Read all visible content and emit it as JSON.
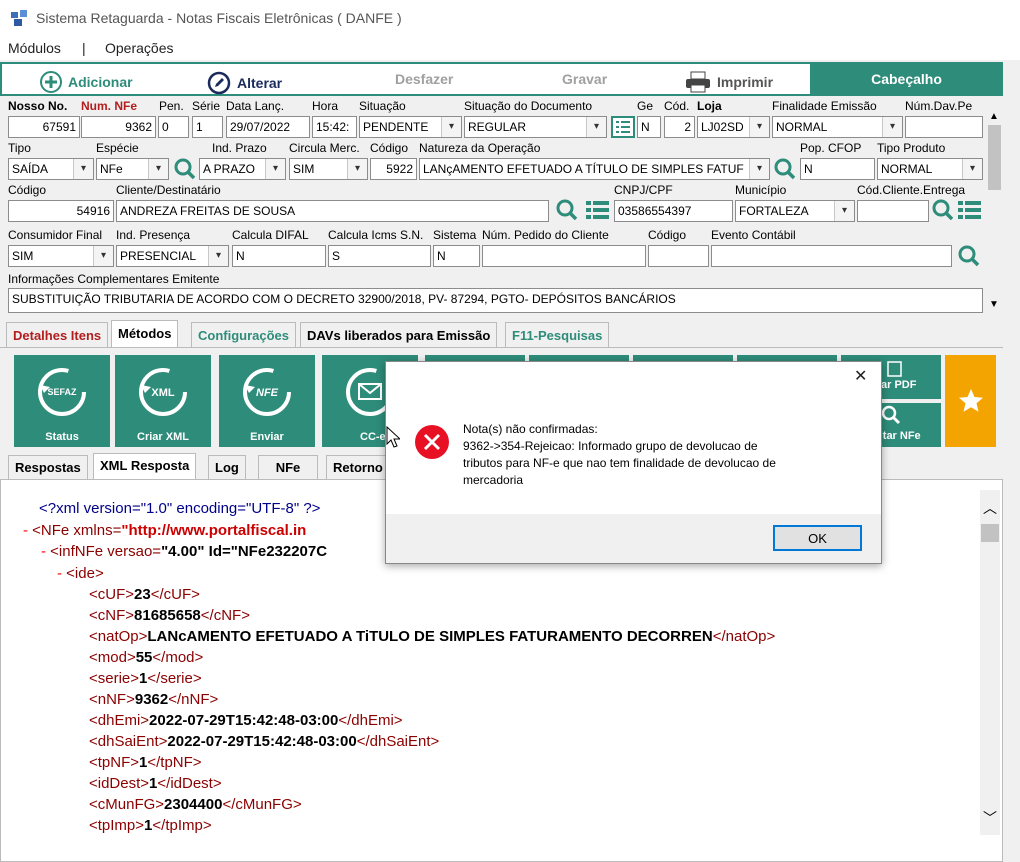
{
  "app": {
    "title": "Sistema Retaguarda - Notas Fiscais Eletrônicas ( DANFE )"
  },
  "menu": {
    "modulos": "Módulos",
    "sep": "|",
    "operacoes": "Operações"
  },
  "toolbar": {
    "adicionar": "Adicionar",
    "alterar": "Alterar",
    "desfazer": "Desfazer",
    "gravar": "Gravar",
    "imprimir": "Imprimir",
    "cabecalho": "Cabeçalho"
  },
  "form": {
    "row1": {
      "labels": {
        "nosso_no": "Nosso No.",
        "num_nfe": "Num. NFe",
        "pen": "Pen.",
        "serie": "Série",
        "data_lanc": "Data Lanç.",
        "hora": "Hora",
        "situacao": "Situação",
        "sit_doc": "Situação do Documento",
        "ge": "Ge",
        "cod": "Cód.",
        "loja": "Loja",
        "finalidade": "Finalidade Emissão",
        "num_dav": "Núm.Dav.Pe"
      },
      "values": {
        "nosso_no": "67591",
        "num_nfe": "9362",
        "pen": "0",
        "serie": "1",
        "data_lanc": "29/07/2022",
        "hora": "15:42:",
        "situacao": "PENDENTE",
        "sit_doc": "REGULAR",
        "ge": "N",
        "cod": "2",
        "loja": "LJ02SD",
        "finalidade": "NORMAL",
        "num_dav": ""
      }
    },
    "row2": {
      "labels": {
        "tipo": "Tipo",
        "especie": "Espécie",
        "ind_prazo": "Ind. Prazo",
        "circula": "Circula Merc.",
        "codigo": "Código",
        "natureza": "Natureza da Operação",
        "pop_cfop": "Pop. CFOP",
        "tipo_produto": "Tipo Produto"
      },
      "values": {
        "tipo": "SAÍDA",
        "especie": "NFe",
        "ind_prazo": "A PRAZO",
        "circula": "SIM",
        "codigo": "5922",
        "natureza": "LANçAMENTO EFETUADO A TÍTULO DE SIMPLES FATUF",
        "pop_cfop": "N",
        "tipo_produto": "NORMAL"
      }
    },
    "row3": {
      "labels": {
        "codigo": "Código",
        "cliente": "Cliente/Destinatário",
        "cnpj": "CNPJ/CPF",
        "municipio": "Município",
        "cod_cliente": "Cód.Cliente.Entrega"
      },
      "values": {
        "codigo": "54916",
        "cliente": "ANDREZA FREITAS DE SOUSA",
        "cnpj": "03586554397",
        "municipio": "FORTALEZA",
        "cod_cliente": ""
      }
    },
    "row4": {
      "labels": {
        "consumidor": "Consumidor Final",
        "ind_presenca": "Ind. Presença",
        "calc_difal": "Calcula DIFAL",
        "calc_icms": "Calcula Icms S.N.",
        "sistema": "Sistema",
        "num_pedido": "Núm. Pedido do Cliente",
        "codigo": "Código",
        "evento": "Evento Contábil"
      },
      "values": {
        "consumidor": "SIM",
        "ind_presenca": "PRESENCIAL",
        "calc_difal": "N",
        "calc_icms": "S",
        "sistema": "N",
        "num_pedido": "",
        "codigo": "",
        "evento": ""
      }
    },
    "info": {
      "label": "Informações Complementares Emitente",
      "value": "SUBSTITUIÇÃO TRIBUTARIA DE ACORDO COM O DECRETO 32900/2018, PV- 87294, PGTO- DEPÓSITOS BANCÁRIOS"
    }
  },
  "tabs": [
    "Detalhes Itens",
    "Métodos",
    "Configurações",
    "DAVs liberados para Emissão",
    "F11-Pesquisas"
  ],
  "tiles": {
    "status": "Status",
    "sefaz": "SEFAZ",
    "xml_glyph": "XML",
    "criar_xml": "Criar XML",
    "nfe_glyph": "NFE",
    "enviar": "Enviar",
    "cce": "CC-e",
    "pdf": "ar PDF",
    "consultar": "ultar NFe"
  },
  "subtabs": [
    "Respostas",
    "XML Resposta",
    "Log",
    "NFe",
    "Retorno"
  ],
  "xml": {
    "decl": "<?xml version=\"1.0\" encoding=\"UTF-8\" ?>",
    "nfe_tag": "<NFe xmlns=",
    "nfe_ns": "\"http://www.portalfiscal.in",
    "infnfe_tag": "<infNFe versao=",
    "infnfe_ver": "\"4.00\"",
    "infnfe_id": " Id=\"NFe232207C",
    "ide": "<ide>",
    "minus": "-",
    "fields": [
      {
        "tag": "cUF",
        "val": "23"
      },
      {
        "tag": "cNF",
        "val": "81685658"
      },
      {
        "tag": "natOp",
        "val": "LANcAMENTO EFETUADO A TiTULO DE SIMPLES FATURAMENTO DECORREN"
      },
      {
        "tag": "mod",
        "val": "55"
      },
      {
        "tag": "serie",
        "val": "1"
      },
      {
        "tag": "nNF",
        "val": "9362"
      },
      {
        "tag": "dhEmi",
        "val": "2022-07-29T15:42:48-03:00"
      },
      {
        "tag": "dhSaiEnt",
        "val": "2022-07-29T15:42:48-03:00"
      },
      {
        "tag": "tpNF",
        "val": "1"
      },
      {
        "tag": "idDest",
        "val": "1"
      },
      {
        "tag": "cMunFG",
        "val": "2304400"
      },
      {
        "tag": "tpImp",
        "val": "1"
      }
    ]
  },
  "dialog": {
    "title": "Nota(s) não confirmadas:",
    "line1": "9362->354-Rejeicao: Informado grupo de devolucao de",
    "line2": "tributos para NF-e que nao tem finalidade de devolucao de",
    "line3": "mercadoria",
    "ok": "OK",
    "close": "✕"
  },
  "colors": {
    "teal": "#2e8c7a",
    "orange": "#f4a400",
    "error_red": "#e81123"
  }
}
